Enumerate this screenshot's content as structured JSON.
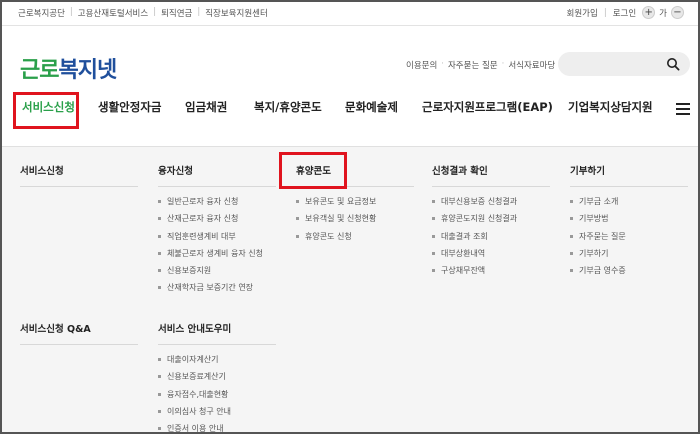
{
  "topbar": {
    "links": [
      "근로복지공단",
      "고용산재토털서비스",
      "퇴직연금",
      "직장보육지원센터"
    ],
    "signup": "회원가입",
    "login": "로그인",
    "zoom_in": "+",
    "font_label": "가",
    "zoom_out": "−"
  },
  "header": {
    "logo_part1": "근로",
    "logo_part2": "복지넷",
    "help_links": [
      "이용문의",
      "자주묻는 질문",
      "서식자료마당"
    ],
    "search_placeholder": ""
  },
  "nav": {
    "items": [
      "서비스신청",
      "생활안정자금",
      "임금채권",
      "복지/휴양콘도",
      "문화예술제",
      "근로자지원프로그램(EAP)",
      "기업복지상담지원"
    ],
    "active_index": 0
  },
  "mega": {
    "columns": [
      {
        "title": "서비스신청",
        "items": []
      },
      {
        "title": "융자신청",
        "items": [
          "일반근로자 융자 신청",
          "산재근로자 융자 신청",
          "직업훈련생계비 대부",
          "체불근로자 생계비 융자 신청",
          "신용보증지원",
          "산재학자금 보증기간 연장"
        ]
      },
      {
        "title": "휴양콘도",
        "items": [
          "보유콘도 및 요금정보",
          "보유객실 및 신청현황",
          "휴양콘도 신청"
        ]
      },
      {
        "title": "신청결과 확인",
        "items": [
          "대부신용보증 신청결과",
          "휴양콘도지원 신청결과",
          "대출결과 조회",
          "대부상환내역",
          "구상채무잔액"
        ]
      },
      {
        "title": "기부하기",
        "items": [
          "기부금 소개",
          "기부방법",
          "자주묻는 질문",
          "기부하기",
          "기부금 영수증"
        ]
      },
      {
        "title": "서비스신청 Q&A",
        "items": []
      },
      {
        "title": "서비스 안내도우미",
        "items": [
          "대출이자계산기",
          "신용보증료계산기",
          "융자접수,대출현황",
          "이의심사 청구 안내",
          "인증서 이용 안내"
        ]
      }
    ]
  },
  "colors": {
    "accent_green": "#2aa04a",
    "logo_blue": "#1f4f9c",
    "highlight_red": "#e0141e"
  }
}
